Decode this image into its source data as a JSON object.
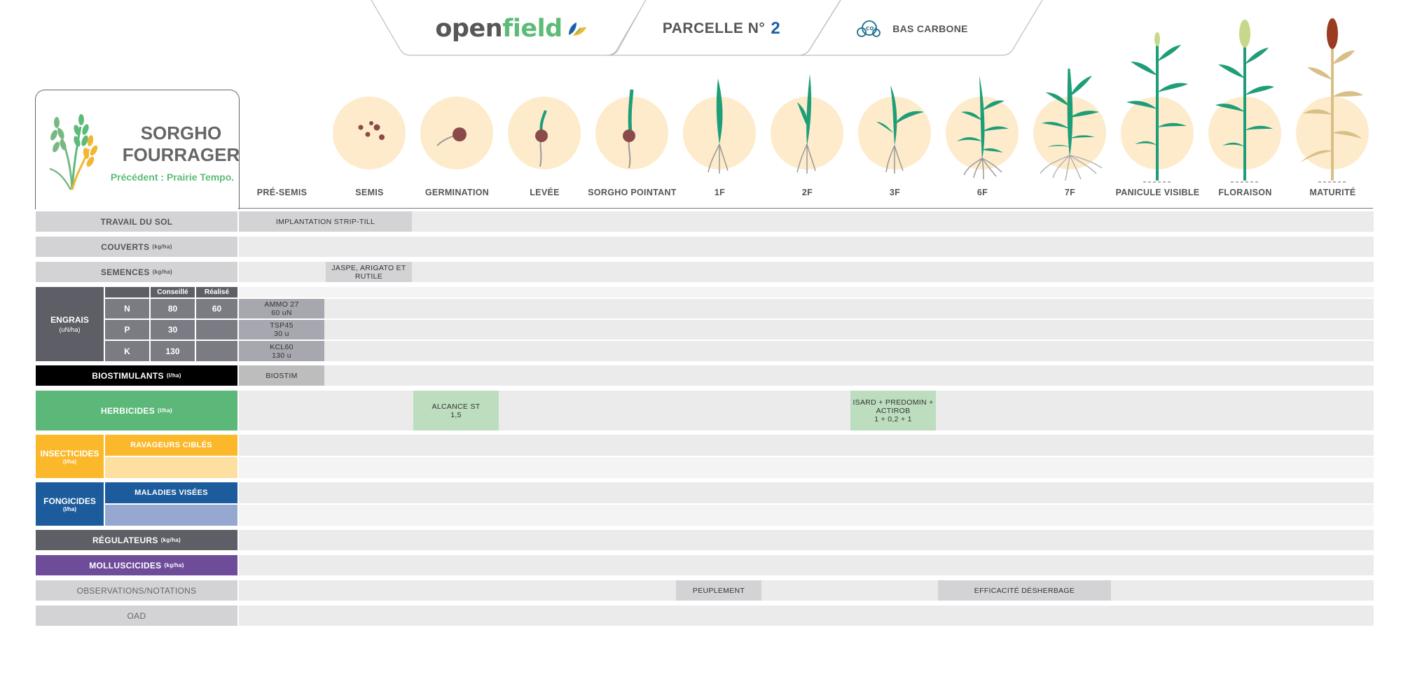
{
  "header": {
    "brand_part1": "open",
    "brand_part2": "field",
    "parcel_label": "PARCELLE N°",
    "parcel_number": "2",
    "carbon_label": "BAS CARBONE"
  },
  "crop": {
    "name_line1": "SORGHO",
    "name_line2": "FOURRAGER",
    "previous": "Précédent : Prairie Tempo."
  },
  "stages": [
    "PRÉ-SEMIS",
    "SEMIS",
    "GERMINATION",
    "LEVÉE",
    "SORGHO POINTANT",
    "1F",
    "2F",
    "3F",
    "6F",
    "7F",
    "PANICULE VISIBLE",
    "FLORAISON",
    "MATURITÉ"
  ],
  "rows": {
    "travail_sol": {
      "label": "TRAVAIL DU SOL",
      "item": "IMPLANTATION STRIP-TILL"
    },
    "couverts": {
      "label": "COUVERTS",
      "unit": "(kg/ha)"
    },
    "semences": {
      "label": "SEMENCES",
      "unit": "(kg/ha)",
      "item": "JASPE, ARIGATO ET RUTILE"
    },
    "engrais": {
      "label": "ENGRAIS",
      "unit": "(uN/ha)",
      "col_conseille": "Conseillé",
      "col_realise": "Réalisé",
      "lines": [
        {
          "element": "N",
          "conseille": "80",
          "realise": "60",
          "product": "AMMO 27",
          "dose": "60 uN"
        },
        {
          "element": "P",
          "conseille": "30",
          "realise": "",
          "product": "TSP45",
          "dose": "30 u"
        },
        {
          "element": "K",
          "conseille": "130",
          "realise": "",
          "product": "KCl60",
          "dose": "130 u"
        }
      ]
    },
    "biostimulants": {
      "label": "BIOSTIMULANTS",
      "unit": "(l/ha)",
      "item": "BIOSTIM"
    },
    "herbicides": {
      "label": "HERBICIDES",
      "unit": "(l/ha)",
      "item1_line1": "ALCANCE ST",
      "item1_line2": "1,5",
      "item2_line1": "ISARD + PREDOMIN +",
      "item2_line2": "ACTIROB",
      "item2_line3": "1 + 0,2 + 1"
    },
    "insecticides": {
      "label": "INSECTICIDES",
      "unit": "(l/ha)",
      "sub": "RAVAGEURS CIBLÉS"
    },
    "fongicides": {
      "label": "FONGICIDES",
      "unit": "(l/ha)",
      "sub": "MALADIES VISÉES"
    },
    "regulateurs": {
      "label": "RÉGULATEURS",
      "unit": "(kg/ha)"
    },
    "molluscicides": {
      "label": "MOLLUSCICIDES",
      "unit": "(kg/ha)"
    },
    "observations": {
      "label": "OBSERVATIONS/NOTATIONS",
      "item1": "PEUPLEMENT",
      "item2": "EFFICACITÉ DÉSHERBAGE"
    },
    "oad": {
      "label": "OAD"
    }
  },
  "colors": {
    "brand_green": "#5dbb78",
    "brand_blue": "#1c5fa8",
    "herbicides": "#5cb878",
    "insecticides": "#fbb82a",
    "fongicides": "#1c5c9c",
    "regulateurs": "#5e5e66",
    "molluscicides": "#6e4c9a",
    "biostimulants": "#000000"
  }
}
